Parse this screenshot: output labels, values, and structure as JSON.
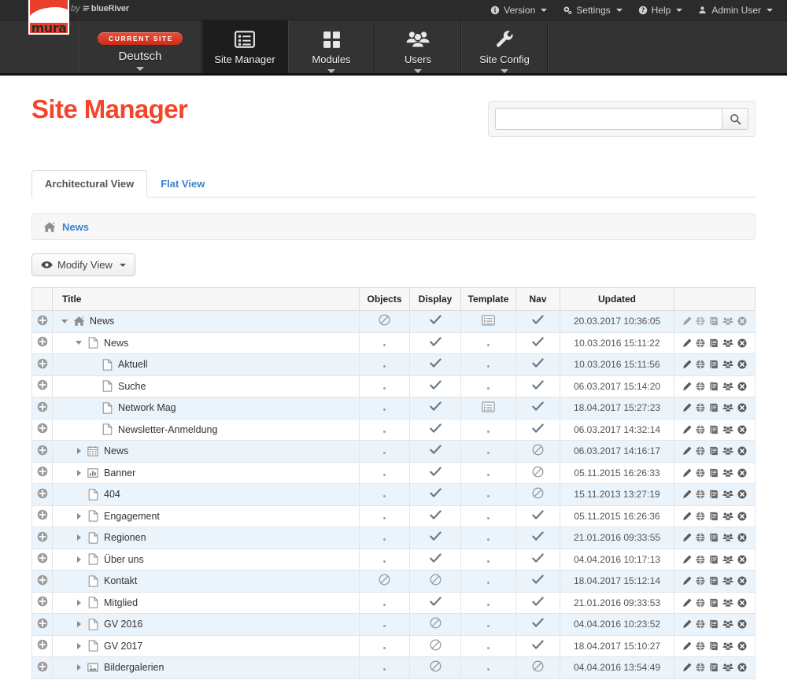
{
  "brand": {
    "logo_word": "mura",
    "byline_prefix": "by",
    "byline_name": "blueRiver"
  },
  "topbar": {
    "items": [
      {
        "label": "Version",
        "icon": "info-icon"
      },
      {
        "label": "Settings",
        "icon": "gears-icon"
      },
      {
        "label": "Help",
        "icon": "question-icon"
      },
      {
        "label": "Admin User",
        "icon": "user-icon"
      }
    ]
  },
  "mainnav": {
    "site_badge": "Current Site",
    "site_label": "Deutsch",
    "tabs": [
      {
        "label": "Site Manager",
        "icon": "list-icon",
        "active": true
      },
      {
        "label": "Modules",
        "icon": "grid-icon",
        "active": false
      },
      {
        "label": "Users",
        "icon": "users-icon",
        "active": false
      },
      {
        "label": "Site Config",
        "icon": "wrench-icon",
        "active": false
      }
    ]
  },
  "header": {
    "title": "Site Manager"
  },
  "search": {
    "value": "",
    "placeholder": "",
    "button_icon": "search-icon"
  },
  "view_tabs": [
    {
      "label": "Architectural View",
      "active": true
    },
    {
      "label": "Flat View",
      "active": false
    }
  ],
  "breadcrumb": {
    "home_icon": "home-icon",
    "items": [
      "News"
    ]
  },
  "toolbar": {
    "modify_view_label": "Modify View",
    "modify_view_icon": "eye-icon"
  },
  "table": {
    "columns": [
      "",
      "Title",
      "Objects",
      "Display",
      "Template",
      "Nav",
      "Updated",
      ""
    ],
    "row_actions": [
      "edit-pencil-icon",
      "globe-icon",
      "book-icon",
      "users-icon",
      "delete-circle-icon"
    ],
    "add_icon": "plus-circle-icon",
    "rows": [
      {
        "title": "News",
        "depth": 0,
        "twisty": "down",
        "icon": "home-icon",
        "objects": "blocked",
        "display": "check",
        "template": "template",
        "nav": "check",
        "updated": "20.03.2017 10:36:05",
        "actions_dim": true
      },
      {
        "title": "News",
        "depth": 1,
        "twisty": "down",
        "icon": "page-icon",
        "objects": "dot",
        "display": "check",
        "template": "dot",
        "nav": "check",
        "updated": "10.03.2016 15:11:22",
        "actions_dim": false
      },
      {
        "title": "Aktuell",
        "depth": 2,
        "twisty": "none",
        "icon": "page-icon",
        "objects": "dot",
        "display": "check",
        "template": "dot",
        "nav": "check",
        "updated": "10.03.2016 15:11:56",
        "actions_dim": false
      },
      {
        "title": "Suche",
        "depth": 2,
        "twisty": "none",
        "icon": "page-icon",
        "objects": "dot",
        "display": "check",
        "template": "dot",
        "nav": "check",
        "updated": "06.03.2017 15:14:20",
        "actions_dim": false
      },
      {
        "title": "Network Mag",
        "depth": 2,
        "twisty": "none",
        "icon": "page-icon",
        "objects": "dot",
        "display": "check",
        "template": "template",
        "nav": "check",
        "updated": "18.04.2017 15:27:23",
        "actions_dim": false
      },
      {
        "title": "Newsletter-Anmeldung",
        "depth": 2,
        "twisty": "none",
        "icon": "page-icon",
        "objects": "dot",
        "display": "check",
        "template": "dot",
        "nav": "check",
        "updated": "06.03.2017 14:32:14",
        "actions_dim": false
      },
      {
        "title": "News",
        "depth": 1,
        "twisty": "right",
        "icon": "calendar-icon",
        "objects": "dot",
        "display": "check",
        "template": "dot",
        "nav": "blocked",
        "updated": "06.03.2017 14:16:17",
        "actions_dim": false
      },
      {
        "title": "Banner",
        "depth": 1,
        "twisty": "right",
        "icon": "chart-icon",
        "objects": "dot",
        "display": "check",
        "template": "dot",
        "nav": "blocked",
        "updated": "05.11.2015 16:26:33",
        "actions_dim": false
      },
      {
        "title": "404",
        "depth": 1,
        "twisty": "none",
        "icon": "page-icon",
        "objects": "dot",
        "display": "check",
        "template": "dot",
        "nav": "blocked",
        "updated": "15.11.2013 13:27:19",
        "actions_dim": false
      },
      {
        "title": "Engagement",
        "depth": 1,
        "twisty": "right",
        "icon": "page-icon",
        "objects": "dot",
        "display": "check",
        "template": "dot",
        "nav": "check",
        "updated": "05.11.2015 16:26:36",
        "actions_dim": false
      },
      {
        "title": "Regionen",
        "depth": 1,
        "twisty": "right",
        "icon": "page-icon",
        "objects": "dot",
        "display": "check",
        "template": "dot",
        "nav": "check",
        "updated": "21.01.2016 09:33:55",
        "actions_dim": false
      },
      {
        "title": "Über uns",
        "depth": 1,
        "twisty": "right",
        "icon": "page-icon",
        "objects": "dot",
        "display": "check",
        "template": "dot",
        "nav": "check",
        "updated": "04.04.2016 10:17:13",
        "actions_dim": false
      },
      {
        "title": "Kontakt",
        "depth": 1,
        "twisty": "none",
        "icon": "page-icon",
        "objects": "blocked",
        "display": "blocked",
        "template": "dot",
        "nav": "check",
        "updated": "18.04.2017 15:12:14",
        "actions_dim": false
      },
      {
        "title": "Mitglied",
        "depth": 1,
        "twisty": "right",
        "icon": "page-icon",
        "objects": "dot",
        "display": "check",
        "template": "dot",
        "nav": "check",
        "updated": "21.01.2016 09:33:53",
        "actions_dim": false
      },
      {
        "title": "GV 2016",
        "depth": 1,
        "twisty": "right",
        "icon": "page-icon",
        "objects": "dot",
        "display": "blocked",
        "template": "dot",
        "nav": "check",
        "updated": "04.04.2016 10:23:52",
        "actions_dim": false
      },
      {
        "title": "GV 2017",
        "depth": 1,
        "twisty": "right",
        "icon": "page-icon",
        "objects": "dot",
        "display": "blocked",
        "template": "dot",
        "nav": "check",
        "updated": "18.04.2017 15:10:27",
        "actions_dim": false
      },
      {
        "title": "Bildergalerien",
        "depth": 1,
        "twisty": "right",
        "icon": "image-icon",
        "objects": "dot",
        "display": "blocked",
        "template": "dot",
        "nav": "blocked",
        "updated": "04.04.2016 13:54:49",
        "actions_dim": false
      }
    ]
  },
  "colors": {
    "brand_red": "#f4452a",
    "link_blue": "#3a81d2",
    "row_stripe": "#ebf4fb",
    "nav_dark": "#333333",
    "topbar_dark": "#2b2b2b"
  }
}
